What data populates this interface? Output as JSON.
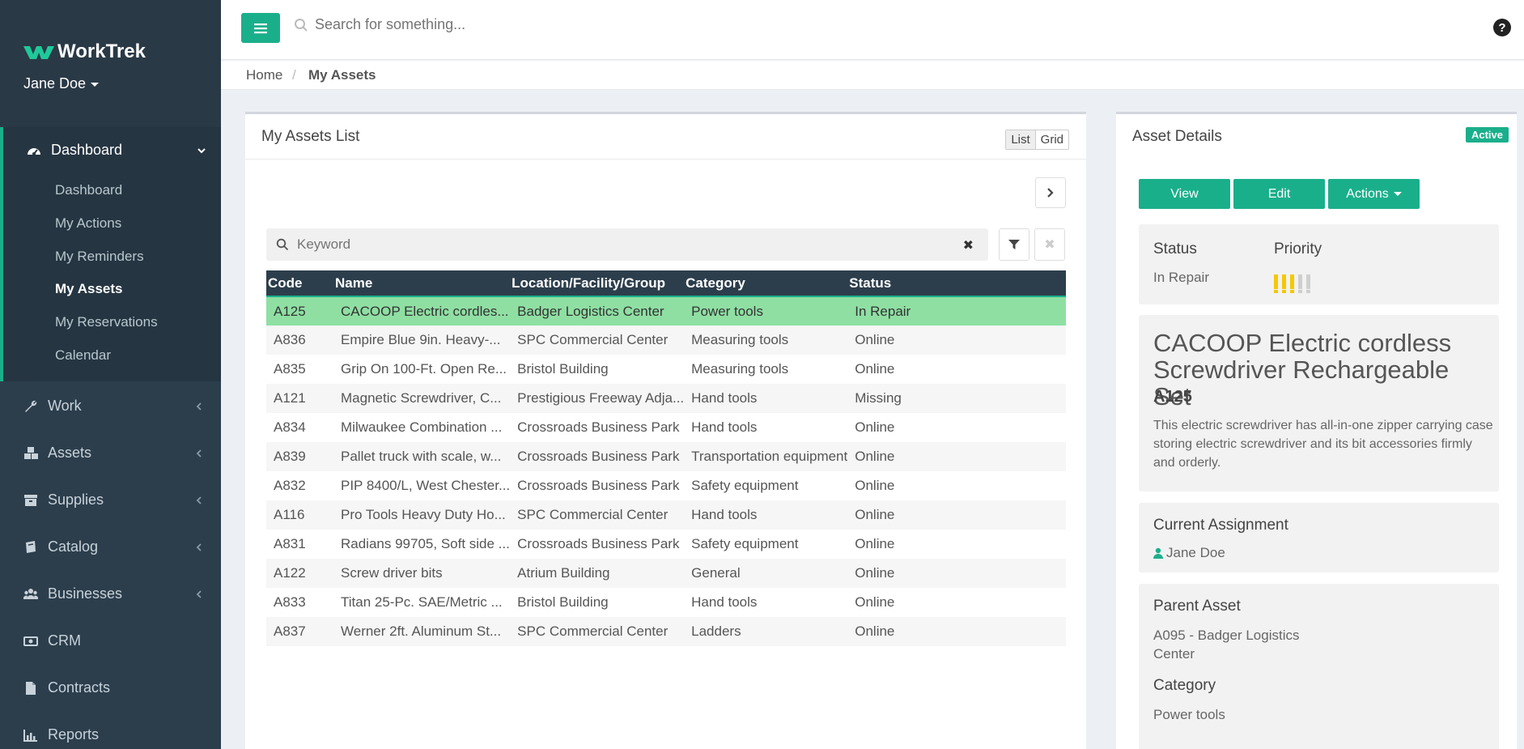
{
  "app": {
    "name": "WorkTrek",
    "user": "Jane Doe"
  },
  "sidebar": {
    "group": {
      "label": "Dashboard",
      "items": [
        "Dashboard",
        "My Actions",
        "My Reminders",
        "My Assets",
        "My Reservations",
        "Calendar"
      ],
      "active": "My Assets"
    },
    "items": [
      {
        "label": "Work",
        "icon": "wrench-icon"
      },
      {
        "label": "Assets",
        "icon": "cubes-icon"
      },
      {
        "label": "Supplies",
        "icon": "archive-icon"
      },
      {
        "label": "Catalog",
        "icon": "book-icon"
      },
      {
        "label": "Businesses",
        "icon": "users-icon"
      },
      {
        "label": "CRM",
        "icon": "money-icon"
      },
      {
        "label": "Contracts",
        "icon": "file-icon"
      },
      {
        "label": "Reports",
        "icon": "bar-chart-icon"
      }
    ]
  },
  "topbar": {
    "search_placeholder": "Search for something..."
  },
  "breadcrumb": {
    "home": "Home",
    "sep": "/",
    "current": "My Assets"
  },
  "list": {
    "title": "My Assets List",
    "view_list": "List",
    "view_grid": "Grid",
    "keyword_placeholder": "Keyword",
    "columns": [
      "Code",
      "Name",
      "Location/Facility/Group",
      "Category",
      "Status"
    ],
    "rows": [
      [
        "A125",
        "CACOOP Electric cordles...",
        "Badger Logistics Center",
        "Power tools",
        "In Repair"
      ],
      [
        "A836",
        "Empire Blue 9in. Heavy-...",
        "SPC Commercial Center",
        "Measuring tools",
        "Online"
      ],
      [
        "A835",
        "Grip On 100-Ft. Open Re...",
        "Bristol Building",
        "Measuring tools",
        "Online"
      ],
      [
        "A121",
        "Magnetic Screwdriver, C...",
        "Prestigious Freeway Adja...",
        "Hand tools",
        "Missing"
      ],
      [
        "A834",
        "Milwaukee Combination ...",
        "Crossroads Business Park",
        "Hand tools",
        "Online"
      ],
      [
        "A839",
        "Pallet truck with scale, w...",
        "Crossroads Business Park",
        "Transportation equipment",
        "Online"
      ],
      [
        "A832",
        "PIP 8400/L, West Chester...",
        "Crossroads Business Park",
        "Safety equipment",
        "Online"
      ],
      [
        "A116",
        "Pro Tools Heavy Duty Ho...",
        "SPC Commercial Center",
        "Hand tools",
        "Online"
      ],
      [
        "A831",
        "Radians 99705, Soft side ...",
        "Crossroads Business Park",
        "Safety equipment",
        "Online"
      ],
      [
        "A122",
        "Screw driver bits",
        "Atrium Building",
        "General",
        "Online"
      ],
      [
        "A833",
        "Titan 25-Pc. SAE/Metric ...",
        "Bristol Building",
        "Hand tools",
        "Online"
      ],
      [
        "A837",
        "Werner 2ft. Aluminum St...",
        "SPC Commercial Center",
        "Ladders",
        "Online"
      ]
    ],
    "selected_index": 0
  },
  "details": {
    "title": "Asset Details",
    "badge": "Active",
    "buttons": {
      "view": "View",
      "edit": "Edit",
      "actions": "Actions"
    },
    "status_label": "Status",
    "status_value": "In Repair",
    "priority_label": "Priority",
    "priority_level": 3,
    "priority_max": 5,
    "name": "CACOOP Electric cordless Screwdriver Rechargeable Set",
    "code": "A125",
    "description": "This electric screwdriver has all-in-one zipper carrying case storing electric screwdriver and its bit accessories firmly and orderly.",
    "assignment_label": "Current Assignment",
    "assignment_value": "Jane Doe",
    "parent_label": "Parent Asset",
    "parent_value": "A095 - Badger Logistics Center",
    "category_label": "Category",
    "category_value": "Power tools"
  },
  "colors": {
    "accent": "#1aaf8b",
    "sidebar": "#2c3e4c",
    "selected_row": "#8fdfa3",
    "priority_on": "#f5c800",
    "priority_off": "#cfcfcf"
  }
}
